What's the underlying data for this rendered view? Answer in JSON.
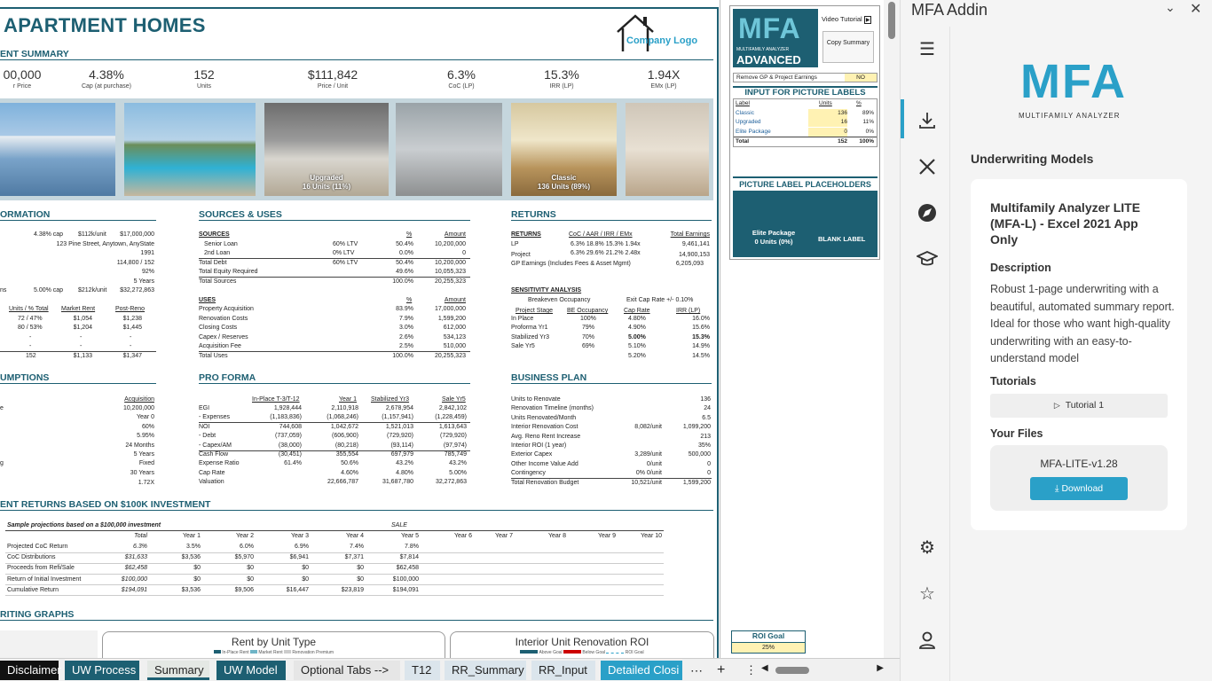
{
  "sheet": {
    "title": "APARTMENT HOMES",
    "company_logo": "Company Logo",
    "summary_header": "ENT SUMMARY",
    "kpis": [
      {
        "value": "00,000",
        "label": "r Price"
      },
      {
        "value": "4.38%",
        "label": "Cap (at purchase)"
      },
      {
        "value": "152",
        "label": "Units"
      },
      {
        "value": "$111,842",
        "label": "Price / Unit"
      },
      {
        "value": "6.3%",
        "label": "CoC (LP)"
      },
      {
        "value": "15.3%",
        "label": "IRR (LP)"
      },
      {
        "value": "1.94X",
        "label": "EMx (LP)"
      }
    ],
    "pic_labels": {
      "upgraded": "Upgraded\n16 Units (11%)",
      "classic": "Classic\n136 Units (89%)"
    },
    "sections": {
      "information": "ORMATION",
      "sources_uses": "SOURCES & USES",
      "returns": "RETURNS",
      "assumptions": "UMPTIONS",
      "pro_forma": "PRO FORMA",
      "business_plan": "BUSINESS PLAN",
      "investment": "ENT RETURNS BASED ON $100K INVESTMENT",
      "graphs": "RITING GRAPHS"
    },
    "info": {
      "row1": [
        "4.38% cap",
        "$112k/unit",
        "$17,000,000"
      ],
      "address": "123 Pine Street, Anytown, AnyState",
      "year": "1991",
      "sqft": "114,800 / 152",
      "occ": "92%",
      "hold": "5 Years",
      "exit": [
        "ns",
        "5.00% cap",
        "$212k/unit",
        "$32,272,863"
      ],
      "unit_headers": [
        "Units / % Total",
        "Market Rent",
        "Post-Reno"
      ],
      "unit_rows": [
        [
          "72 / 47%",
          "$1,054",
          "$1,238"
        ],
        [
          "80 / 53%",
          "$1,204",
          "$1,445"
        ],
        [
          "-",
          "-",
          "-"
        ],
        [
          "-",
          "-",
          "-"
        ]
      ],
      "unit_total": [
        "152",
        "$1,133",
        "$1,347"
      ]
    },
    "sources": {
      "headers": [
        "SOURCES",
        "%",
        "Amount"
      ],
      "rows": [
        [
          "Senior Loan",
          "60% LTV",
          "50.4%",
          "10,200,000"
        ],
        [
          "2nd Loan",
          "0% LTV",
          "0.0%",
          "0"
        ],
        [
          "Total Debt",
          "60% LTV",
          "50.4%",
          "10,200,000"
        ],
        [
          "Total Equity Required",
          "",
          "49.6%",
          "10,055,323"
        ],
        [
          "Total Sources",
          "",
          "100.0%",
          "20,255,323"
        ]
      ],
      "uses_headers": [
        "USES",
        "%",
        "Amount"
      ],
      "uses": [
        [
          "Property Acquisition",
          "83.9%",
          "17,000,000"
        ],
        [
          "Renovation Costs",
          "7.9%",
          "1,599,200"
        ],
        [
          "Closing Costs",
          "3.0%",
          "612,000"
        ],
        [
          "Capex / Reserves",
          "2.6%",
          "534,123"
        ],
        [
          "Acquisition Fee",
          "2.5%",
          "510,000"
        ],
        [
          "Total Uses",
          "100.0%",
          "20,255,323"
        ]
      ]
    },
    "returns": {
      "headers": [
        "RETURNS",
        "CoC  /  AAR  /  IRR  /  EMx",
        "Total Earnings"
      ],
      "rows": [
        [
          "LP",
          "6.3%  18.8%  15.3%  1.94x",
          "9,461,141"
        ],
        [
          "Project",
          "6.3%  29.6%  21.2%  2.48x",
          "14,900,153"
        ],
        [
          "GP Earnings (Includes Fees & Asset Mgmt)",
          "",
          "6,205,093"
        ]
      ],
      "sens_title": "SENSITIVITY ANALYSIS",
      "sens_sub1": "Breakeven Occupancy",
      "sens_sub2": "Exit Cap Rate +/- 0.10%",
      "sens_headers": [
        "Project Stage",
        "BE Occupancy",
        "Cap Rate",
        "IRR (LP)"
      ],
      "sens_rows": [
        [
          "In Place",
          "100%",
          "4.80%",
          "16.0%"
        ],
        [
          "Proforma Yr1",
          "79%",
          "4.90%",
          "15.6%"
        ],
        [
          "Stabilized Yr3",
          "70%",
          "5.00%",
          "15.3%"
        ],
        [
          "Sale Yr5",
          "69%",
          "5.10%",
          "14.9%"
        ],
        [
          "",
          "",
          "5.20%",
          "14.5%"
        ]
      ]
    },
    "assumptions": {
      "header": "Acquisition",
      "rows": [
        [
          "e",
          "10,200,000"
        ],
        [
          "",
          "Year 0"
        ],
        [
          "",
          "60%"
        ],
        [
          "",
          "5.95%"
        ],
        [
          "",
          "24 Months"
        ],
        [
          "",
          "5 Years"
        ],
        [
          "g",
          "Fixed"
        ],
        [
          "",
          "30 Years"
        ],
        [
          "",
          "1.72X"
        ]
      ]
    },
    "pro_forma": {
      "headers": [
        "In-Place T-3/T-12",
        "Year 1",
        "Stabilized Yr3",
        "Sale Yr5"
      ],
      "rows": [
        [
          "EGI",
          "1,928,444",
          "2,110,918",
          "2,678,954",
          "2,842,102"
        ],
        [
          "- Expenses",
          "(1,183,836)",
          "(1,068,246)",
          "(1,157,941)",
          "(1,228,459)"
        ],
        [
          "NOI",
          "744,608",
          "1,042,672",
          "1,521,013",
          "1,613,643"
        ],
        [
          "- Debt",
          "(737,059)",
          "(606,900)",
          "(729,920)",
          "(729,920)"
        ],
        [
          "- Capex/AM",
          "(38,000)",
          "(80,218)",
          "(93,114)",
          "(97,974)"
        ],
        [
          "Cash Flow",
          "(30,451)",
          "355,554",
          "697,979",
          "785,749"
        ],
        [
          "Expense Ratio",
          "61.4%",
          "50.6%",
          "43.2%",
          "43.2%"
        ],
        [
          "Cap Rate",
          "",
          "4.60%",
          "4.80%",
          "5.00%"
        ],
        [
          "Valuation",
          "",
          "22,666,787",
          "31,687,780",
          "32,272,863"
        ]
      ]
    },
    "business_plan": {
      "rows": [
        [
          "Units to Renovate",
          "",
          "136"
        ],
        [
          "Renovation Timeline (months)",
          "",
          "24"
        ],
        [
          "Units Renovated/Month",
          "",
          "6.5"
        ],
        [
          "Interior Renovation Cost",
          "8,082/unit",
          "1,099,200"
        ],
        [
          "Avg. Reno Rent Increase",
          "",
          "213"
        ],
        [
          "Interior ROI (1 year)",
          "",
          "35%"
        ],
        [
          "Exterior Capex",
          "3,289/unit",
          "500,000"
        ],
        [
          "Other Income Value Add",
          "0/unit",
          "0"
        ],
        [
          "Contingency",
          "0%  0/unit",
          "0"
        ],
        [
          "Total Renovation Budget",
          "10,521/unit",
          "1,599,200"
        ]
      ]
    },
    "investment": {
      "subtitle": "Sample projections based on a $100,000 investment",
      "sale": "SALE",
      "headers": [
        "Total",
        "Year 1",
        "Year 2",
        "Year 3",
        "Year 4",
        "Year 5",
        "Year 6",
        "Year 7",
        "Year 8",
        "Year 9",
        "Year 10"
      ],
      "rows": [
        [
          "Projected CoC Return",
          "6.3%",
          "3.5%",
          "6.0%",
          "6.9%",
          "7.4%",
          "7.8%"
        ],
        [
          "CoC Distributions",
          "$31,633",
          "$3,536",
          "$5,970",
          "$6,941",
          "$7,371",
          "$7,814"
        ],
        [
          "Proceeds from Refi/Sale",
          "$62,458",
          "$0",
          "$0",
          "$0",
          "$0",
          "$62,458"
        ],
        [
          "Return of Initial Investment",
          "$100,000",
          "$0",
          "$0",
          "$0",
          "$0",
          "$100,000"
        ],
        [
          "Cumulative Return",
          "$194,091",
          "$3,536",
          "$9,506",
          "$16,447",
          "$23,819",
          "$194,091"
        ]
      ]
    },
    "charts": [
      {
        "title": "Rent by Unit Type",
        "legend": [
          "In-Place Rent",
          "Market Rent",
          "Renovation Premium"
        ]
      },
      {
        "title": "Interior Unit Renovation ROI",
        "legend": [
          "Above Goal",
          "Below Goal",
          "ROI Goal"
        ]
      }
    ]
  },
  "panel": {
    "logo_text": "ADVANCED",
    "logo_sub": "MULTIFAMILY ANALYZER",
    "video_tutorial": "Video Tutorial",
    "copy_summary": "Copy Summary",
    "remove_gp": "Remove GP & Project Earnings",
    "remove_gp_value": "NO",
    "input_title": "INPUT FOR PICTURE LABELS",
    "input_headers": [
      "Label",
      "Units",
      "%"
    ],
    "input_rows": [
      [
        "Classic",
        "136",
        "89%"
      ],
      [
        "Upgraded",
        "16",
        "11%"
      ],
      [
        "Elite Package",
        "0",
        "0%"
      ],
      [
        "Total",
        "152",
        "100%"
      ]
    ],
    "placeholder_title": "PICTURE LABEL PLACEHOLDERS",
    "elite": "Elite Package\n0 Units (0%)",
    "blank": "BLANK LABEL",
    "roi_goal": "ROI Goal",
    "roi_value": "25%"
  },
  "tabs": [
    "Disclaimer",
    "UW Process",
    "Summary",
    "UW Model",
    "Optional Tabs -->",
    "T12",
    "RR_Summary",
    "RR_Input",
    "Detailed Closi"
  ],
  "addin": {
    "title": "MFA Addin",
    "brand": "MULTIFAMILY ANALYZER",
    "section": "Underwriting Models",
    "card_title": "Multifamily Analyzer LITE (MFA-L) - Excel 2021 App Only",
    "desc_label": "Description",
    "desc": "Robust 1-page underwriting with a beautiful, automated summary report. Ideal for those who want high-quality underwriting with an easy-to-understand model",
    "tutorials_label": "Tutorials",
    "tutorial_btn": "Tutorial 1",
    "files_label": "Your Files",
    "file_name": "MFA-LITE-v1.28",
    "download": "Download"
  }
}
